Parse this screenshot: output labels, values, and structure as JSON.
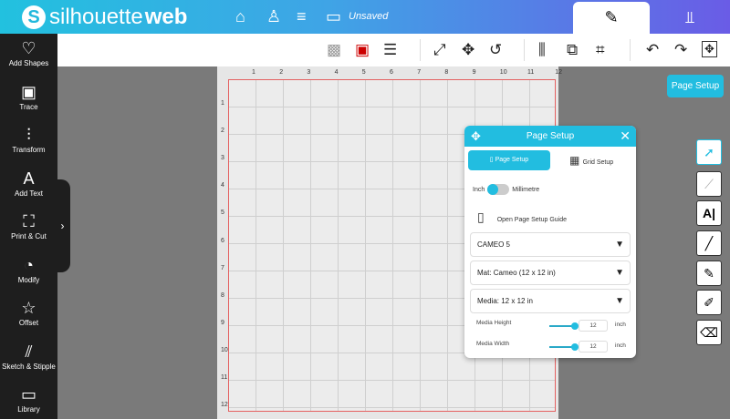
{
  "header": {
    "logo_light": "silhouette",
    "logo_bold": "web",
    "logo_mark": "S",
    "status": "Unsaved"
  },
  "sidebar": [
    {
      "label": "Add Shapes",
      "icon": "♡"
    },
    {
      "label": "Trace",
      "icon": "▣"
    },
    {
      "label": "Transform",
      "icon": "⫶"
    },
    {
      "label": "Add Text",
      "icon": "A"
    },
    {
      "label": "Print & Cut",
      "icon": "⛶"
    },
    {
      "label": "Modify",
      "icon": "◔"
    },
    {
      "label": "Offset",
      "icon": "☆"
    },
    {
      "label": "Sketch & Stipple",
      "icon": "⫽"
    },
    {
      "label": "Library",
      "icon": "▭"
    }
  ],
  "ruler": {
    "top": [
      "1",
      "2",
      "3",
      "4",
      "5",
      "6",
      "7",
      "8",
      "9",
      "10",
      "11",
      "12"
    ],
    "left": [
      "1",
      "2",
      "3",
      "4",
      "5",
      "6",
      "7",
      "8",
      "9",
      "10",
      "11",
      "12"
    ]
  },
  "page_setup_button": "Page Setup",
  "dialog": {
    "title": "Page Setup",
    "tab_page": "Page Setup",
    "tab_grid": "Grid Setup",
    "unit_inch": "Inch",
    "unit_mm": "Millimetre",
    "guide": "Open Page Setup Guide",
    "machine": "CAMEO 5",
    "mat": "Mat: Cameo (12 x 12 in)",
    "media": "Media: 12 x 12 in",
    "height_label": "Media Height",
    "height_value": "12",
    "width_label": "Media Width",
    "width_value": "12",
    "unit": "inch"
  }
}
